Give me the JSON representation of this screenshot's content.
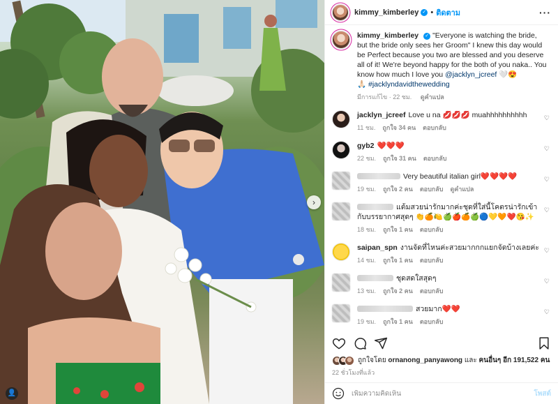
{
  "post": {
    "username": "kimmy_kimberley",
    "follow_label": "ติดตาม",
    "caption_text": "\"Everyone is watching the bride, but the bride only sees her Groom\" I knew this day would be Perfect because you two are blessed and you deserve all of it! We're beyond happy for the both of you naka.. You know how much I love you ",
    "caption_mention": "@jacklyn_jcreef",
    "caption_hashtag": "#jacklyndavidthewedding",
    "caption_meta_edited": "มีการแก้ไข · 22 ชม.",
    "caption_meta_translate": "ดูคำแปล"
  },
  "comments": [
    {
      "username": "jacklyn_jcreef",
      "text": "Love u na 💋💋💋 muahhhhhhhhhh",
      "time": "11 ชม.",
      "likes": "ถูกใจ 34 คน",
      "reply": "ตอบกลับ",
      "blurred": false
    },
    {
      "username": "gyb2",
      "text": "❤️❤️❤️",
      "time": "22 ชม.",
      "likes": "ถูกใจ 31 คน",
      "reply": "ตอบกลับ",
      "blurred": false
    },
    {
      "username": "",
      "text": "Very beautiful italian girl❤️❤️❤️❤️",
      "time": "19 ชม.",
      "likes": "ถูกใจ 2 คน",
      "reply": "ตอบกลับ",
      "translate": "ดูคำแปล",
      "blurred": true
    },
    {
      "username": "",
      "text": "แต้มสวยน่ารักมากค่ะชุดที่ใส่นี้โคตรน่ารักเข้ากับบรรยากาศสุดๆ 👏🍊🍋🍏🍎🍊🍏🔵💛🧡❤️😘✨",
      "time": "18 ชม.",
      "likes": "ถูกใจ 1 คน",
      "reply": "ตอบกลับ",
      "blurred": true
    },
    {
      "username": "saipan_spn",
      "text": "งานจัดที่ไหนค่ะสวยมากกกแยกจัดบ้างเลยค่ะ",
      "time": "14 ชม.",
      "likes": "ถูกใจ 1 คน",
      "reply": "ตอบกลับ",
      "blurred": false
    },
    {
      "username": "",
      "text": "ชุดสดใสสุดๆ",
      "time": "13 ชม.",
      "likes": "ถูกใจ 2 คน",
      "reply": "ตอบกลับ",
      "blurred": true
    },
    {
      "username": "",
      "text": "สวยมาก❤️❤️",
      "time": "19 ชม.",
      "likes": "ถูกใจ 1 คน",
      "reply": "ตอบกลับ",
      "blurred": true
    }
  ],
  "likes_summary": {
    "prefix": "ถูกใจโดย",
    "user": "ornanong_panyawong",
    "middle": "และ",
    "others": "คนอื่นๆ อีก 191,522 คน"
  },
  "posted_time": "22 ชั่วโมงที่แล้ว",
  "comment_box": {
    "placeholder": "เพิ่มความคิดเห็น",
    "post_label": "โพสต์"
  },
  "colors": {
    "link": "#00376b",
    "follow": "#0095f6",
    "verified": "#0095f6",
    "meta_gray": "#8e8e8e"
  },
  "icons": [
    "heart-icon",
    "comment-icon",
    "share-icon",
    "bookmark-icon",
    "emoji-icon",
    "more-icon",
    "verified-icon",
    "chevron-right-icon"
  ]
}
